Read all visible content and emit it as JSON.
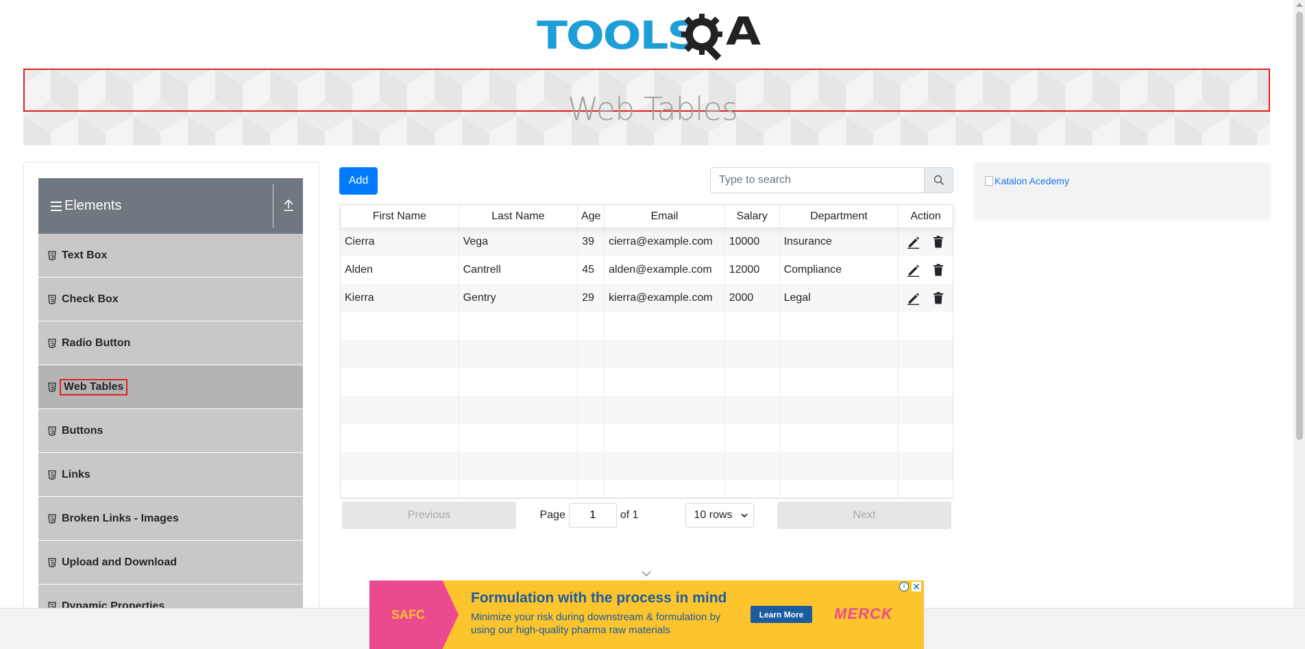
{
  "brand": {
    "logo_text_left": "TOOLS",
    "logo_text_right": "A"
  },
  "page": {
    "title": "Web Tables"
  },
  "sidebar": {
    "group_title": "Elements",
    "items": [
      {
        "label": "Text Box",
        "active": false
      },
      {
        "label": "Check Box",
        "active": false
      },
      {
        "label": "Radio Button",
        "active": false
      },
      {
        "label": "Web Tables",
        "active": true
      },
      {
        "label": "Buttons",
        "active": false
      },
      {
        "label": "Links",
        "active": false
      },
      {
        "label": "Broken Links - Images",
        "active": false
      },
      {
        "label": "Upload and Download",
        "active": false
      },
      {
        "label": "Dynamic Properties",
        "active": false
      }
    ]
  },
  "toolbar": {
    "add_label": "Add",
    "search_placeholder": "Type to search",
    "search_value": ""
  },
  "table": {
    "columns": [
      "First Name",
      "Last Name",
      "Age",
      "Email",
      "Salary",
      "Department",
      "Action"
    ],
    "rows": [
      {
        "first": "Cierra",
        "last": "Vega",
        "age": "39",
        "email": "cierra@example.com",
        "salary": "10000",
        "department": "Insurance"
      },
      {
        "first": "Alden",
        "last": "Cantrell",
        "age": "45",
        "email": "alden@example.com",
        "salary": "12000",
        "department": "Compliance"
      },
      {
        "first": "Kierra",
        "last": "Gentry",
        "age": "29",
        "email": "kierra@example.com",
        "salary": "2000",
        "department": "Legal"
      }
    ],
    "empty_rows": 7
  },
  "pagination": {
    "previous_label": "Previous",
    "page_label": "Page",
    "page_value": "1",
    "of_label": "of 1",
    "rows_option": "10 rows",
    "next_label": "Next"
  },
  "side_ad": {
    "alt_text": "Katalon Acedemy"
  },
  "bottom_ad": {
    "brand": "SAFC",
    "headline": "Formulation with the process in mind",
    "copy": "Minimize your risk during downstream & formulation by using our high-quality pharma raw materials",
    "cta": "Learn More",
    "logo": "MERCK"
  },
  "colors": {
    "primary": "#007bff",
    "sidebar_header": "#6f7780",
    "menu_item": "#c8c8c8",
    "highlight_outline": "#e01e1e",
    "logo_blue": "#1e9ed8"
  }
}
